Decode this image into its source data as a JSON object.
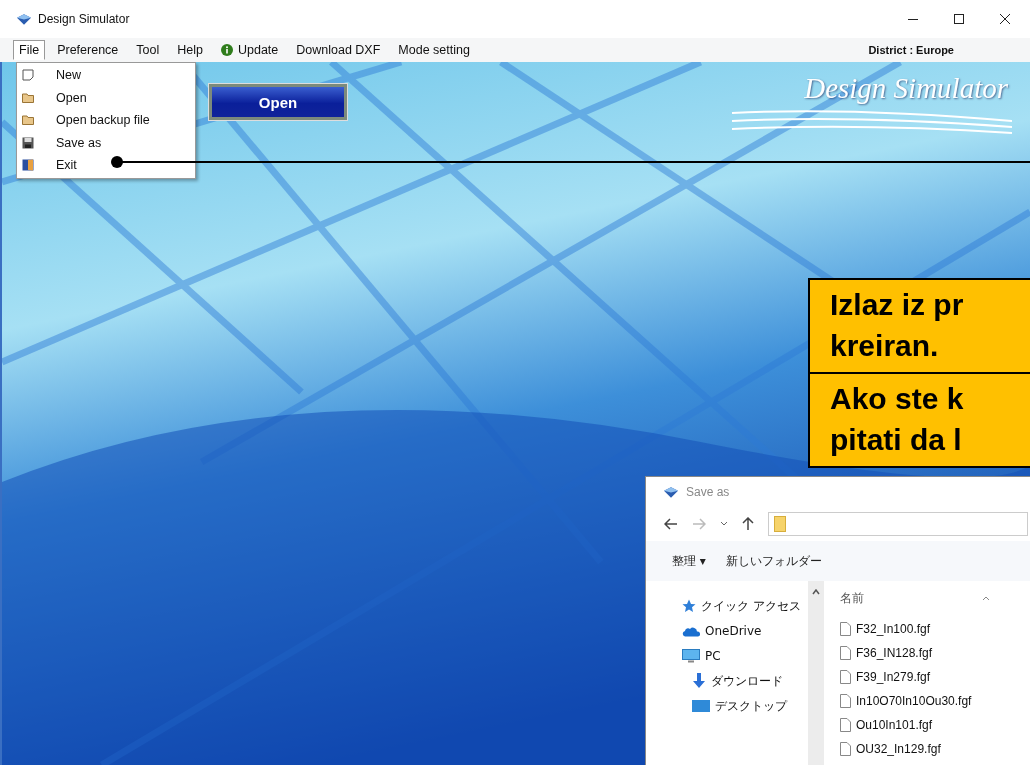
{
  "window": {
    "title": "Design Simulator"
  },
  "menubar": [
    {
      "label": "File",
      "kind": "plain",
      "selected": true
    },
    {
      "label": "Preference",
      "kind": "plain",
      "selected": false
    },
    {
      "label": "Tool",
      "kind": "plain",
      "selected": false
    },
    {
      "label": "Help",
      "kind": "plain",
      "selected": false
    },
    {
      "label": "Update",
      "kind": "info",
      "selected": false
    },
    {
      "label": "Download DXF",
      "kind": "plain",
      "selected": false
    },
    {
      "label": "Mode setting",
      "kind": "plain",
      "selected": false
    }
  ],
  "district": "District : Europe",
  "file_menu": [
    {
      "label": "New",
      "kind": "page"
    },
    {
      "label": "Open",
      "kind": "folder"
    },
    {
      "label": "Open backup file",
      "kind": "folder"
    },
    {
      "label": "Save as",
      "kind": "disk"
    },
    {
      "label": "Exit",
      "kind": "door"
    }
  ],
  "open_button": "Open",
  "logo": "Design Simulator",
  "callouts": [
    {
      "lines": [
        "Izlaz iz pr",
        "kreiran."
      ]
    },
    {
      "lines": [
        "Ako ste k",
        "pitati da l"
      ]
    }
  ],
  "dialog": {
    "title": "Save as",
    "toolbar": [
      {
        "label": "整理 ▾"
      },
      {
        "label": "新しいフォルダー"
      }
    ],
    "nav": [
      {
        "label": "クイック アクセス",
        "kind": "star"
      },
      {
        "label": "OneDrive",
        "kind": "cloud"
      },
      {
        "label": "PC",
        "kind": "pc"
      },
      {
        "label": "ダウンロード",
        "kind": "download"
      },
      {
        "label": "デスクトップ",
        "kind": "desktop"
      }
    ],
    "column": "名前",
    "files": [
      "F32_In100.fgf",
      "F36_IN128.fgf",
      "F39_In279.fgf",
      "In10O70In10Ou30.fgf",
      "Ou10In101.fgf",
      "OU32_In129.fgf"
    ]
  }
}
